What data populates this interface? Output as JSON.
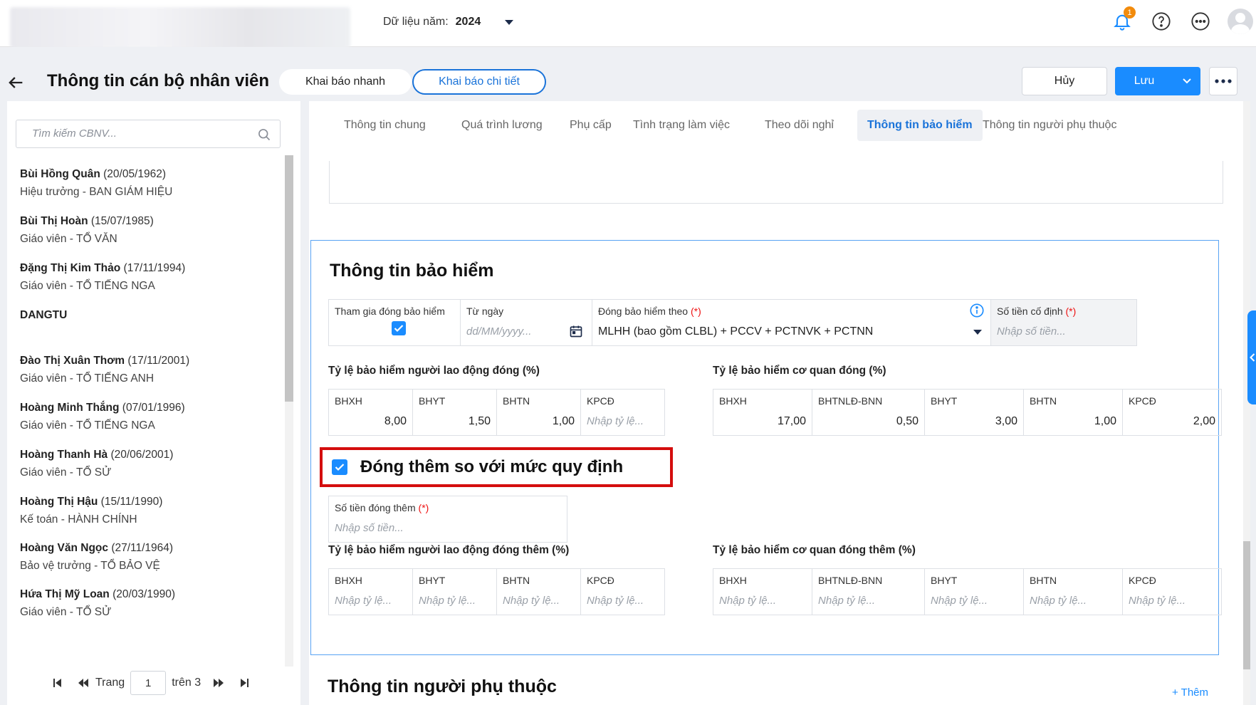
{
  "topbar": {
    "year_label": "Dữ liệu năm:",
    "year_value": "2024",
    "notification_count": "1",
    "icons": [
      "bell-icon",
      "help-icon",
      "more-horizontal-icon",
      "avatar"
    ]
  },
  "header": {
    "title": "Thông tin cán bộ nhân viên",
    "mode_quick": "Khai báo nhanh",
    "mode_detail": "Khai báo chi tiết",
    "cancel": "Hủy",
    "save": "Lưu"
  },
  "sidebar": {
    "search_placeholder": "Tìm kiếm CBNV...",
    "employees": [
      {
        "name": "Bùi Hồng Quân",
        "dob": "(20/05/1962)",
        "role": "Hiệu trưởng - BAN GIÁM HIỆU"
      },
      {
        "name": "Bùi Thị Hoàn",
        "dob": "(15/07/1985)",
        "role": "Giáo viên - TỔ VĂN"
      },
      {
        "name": "Đặng Thị Kim Thảo",
        "dob": "(17/11/1994)",
        "role": "Giáo viên - TỔ TIẾNG NGA"
      },
      {
        "name": "DANGTU",
        "dob": "",
        "role": ""
      },
      {
        "name": "Đào Thị Xuân Thơm",
        "dob": "(17/11/2001)",
        "role": "Giáo viên - TỔ TIẾNG ANH"
      },
      {
        "name": "Hoàng Minh Thắng",
        "dob": "(07/01/1996)",
        "role": "Giáo viên - TỔ TIẾNG NGA"
      },
      {
        "name": "Hoàng Thanh Hà",
        "dob": "(20/06/2001)",
        "role": "Giáo viên - TỔ SỬ"
      },
      {
        "name": "Hoàng Thị Hậu",
        "dob": "(15/11/1990)",
        "role": "Kế toán - HÀNH CHÍNH"
      },
      {
        "name": "Hoàng Văn Ngọc",
        "dob": "(27/11/1964)",
        "role": "Bảo vệ trưởng - TỔ BẢO VỆ"
      },
      {
        "name": "Hứa Thị Mỹ Loan",
        "dob": "(20/03/1990)",
        "role": "Giáo viên - TỔ SỬ"
      }
    ],
    "pager": {
      "label": "Trang",
      "current": "1",
      "of": "trên 3"
    }
  },
  "tabs": [
    {
      "label": "Thông tin chung",
      "active": false
    },
    {
      "label": "Quá trình lương",
      "active": false
    },
    {
      "label": "Phụ cấp",
      "active": false
    },
    {
      "label": "Tình trạng làm việc",
      "active": false
    },
    {
      "label": "Theo dõi nghỉ",
      "active": false
    },
    {
      "label": "Thông tin bảo hiểm",
      "active": true
    },
    {
      "label": "Thông tin người phụ thuộc",
      "active": false
    }
  ],
  "insurance": {
    "title": "Thông tin bảo hiểm",
    "participate_label": "Tham gia đóng bảo hiểm",
    "participate_checked": true,
    "from_date_label": "Từ ngày",
    "from_date_placeholder": "dd/MM/yyyy...",
    "basis_label": "Đóng bảo hiểm theo",
    "basis_value": "MLHH (bao gồm CLBL) + PCCV + PCTNVK + PCTNN",
    "fixed_amount_label": "Số tiền cố định",
    "fixed_amount_placeholder": "Nhập số tiền...",
    "required_mark": "(*)",
    "employee_rate_label": "Tỷ lệ bảo hiểm người lao động đóng (%)",
    "employee_rates": [
      {
        "head": "BHXH",
        "value": "8,00"
      },
      {
        "head": "BHYT",
        "value": "1,50"
      },
      {
        "head": "BHTN",
        "value": "1,00"
      },
      {
        "head": "KPCĐ",
        "value": ""
      }
    ],
    "agency_rate_label": "Tỷ lệ bảo hiểm cơ quan đóng (%)",
    "agency_rates": [
      {
        "head": "BHXH",
        "value": "17,00"
      },
      {
        "head": "BHTNLĐ-BNN",
        "value": "0,50"
      },
      {
        "head": "BHYT",
        "value": "3,00"
      },
      {
        "head": "BHTN",
        "value": "1,00"
      },
      {
        "head": "KPCĐ",
        "value": "2,00"
      }
    ],
    "rate_placeholder": "Nhập tỷ lệ...",
    "extra_label": "Đóng thêm so với mức quy định",
    "extra_checked": true,
    "extra_amount_label": "Số tiền đóng thêm",
    "extra_amount_placeholder": "Nhập số tiền...",
    "employee_extra_label": "Tỷ lệ bảo hiểm người lao động đóng thêm (%)",
    "employee_extra_heads": [
      "BHXH",
      "BHYT",
      "BHTN",
      "KPCĐ"
    ],
    "agency_extra_label": "Tỷ lệ bảo hiểm cơ quan đóng thêm (%)",
    "agency_extra_heads": [
      "BHXH",
      "BHTNLĐ-BNN",
      "BHYT",
      "BHTN",
      "KPCĐ"
    ]
  },
  "dependents": {
    "title": "Thông tin người phụ thuộc",
    "add": "+ Thêm"
  },
  "colors": {
    "accent": "#1a8cff",
    "highlight_box": "#d40d0d",
    "badge": "#f28b0c"
  }
}
